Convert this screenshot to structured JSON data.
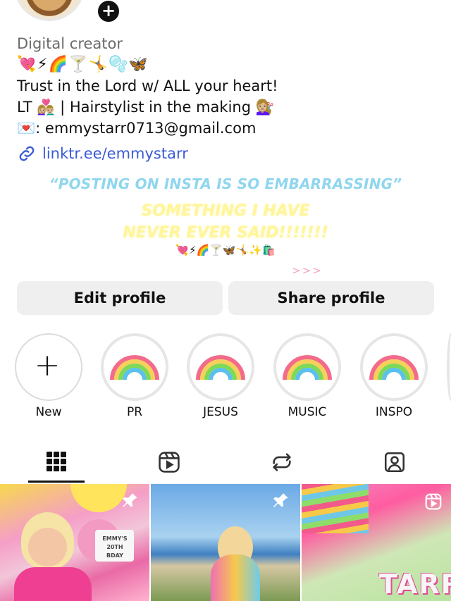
{
  "profile": {
    "category": "Digital creator",
    "emoji_row": "💘⚡🌈🍸🤸🫧🦋",
    "bio_line_1": "Trust in the Lord w/ ALL your heart!",
    "bio_line_2": "LT 👩🏼‍❤️‍👨🏼 | Hairstylist in the making 💇🏼‍♀️",
    "bio_line_3": "💌: emmystarr0713@gmail.com",
    "link": "linktr.ee/emmystarr"
  },
  "banner": {
    "quote": "“POSTING ON INSTA IS SO EMBARRASSING”",
    "yellow_line_1": "SOMETHING I HAVE",
    "yellow_line_2": "NEVER EVER SAID!!!!!!!",
    "emoji_strip": "💘⚡🌈🍸🦋🤸✨🛍️",
    "arrows": ">>>"
  },
  "buttons": {
    "edit": "Edit profile",
    "share": "Share profile"
  },
  "highlights": [
    {
      "label": "New"
    },
    {
      "label": "PR"
    },
    {
      "label": "JESUS"
    },
    {
      "label": "MUSIC"
    },
    {
      "label": "INSPO"
    }
  ],
  "tabs": [
    "grid-icon",
    "reels-icon",
    "reposts-icon",
    "tagged-icon"
  ],
  "posts": [
    {
      "overlay_text": "EMMY'S 20TH BDAY",
      "pinned": true
    },
    {
      "pinned": true
    },
    {
      "overlay_text": "TARR",
      "reel": true
    }
  ],
  "colors": {
    "link": "#3b5bd6",
    "quote": "#8fd6ef",
    "yellow_text": "#fff59a",
    "button_bg": "#efefef"
  }
}
